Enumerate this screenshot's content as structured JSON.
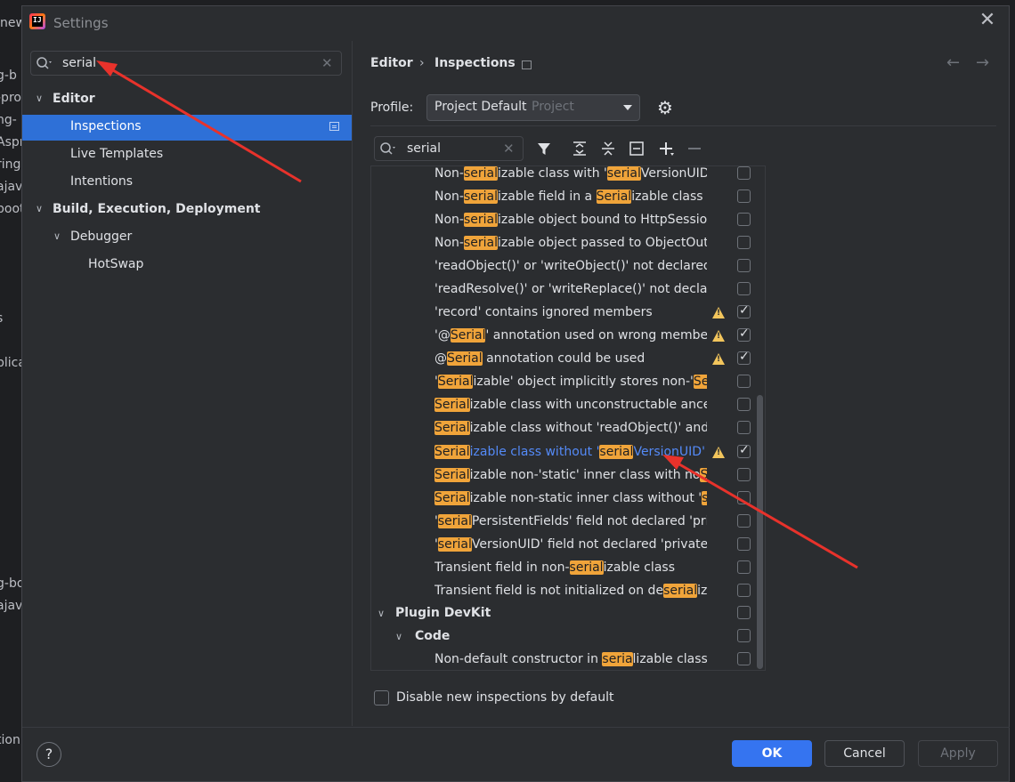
{
  "background": {
    "left_fragments": [
      "new",
      "g-b",
      "-pro",
      "ng-",
      "Aspr",
      "ring",
      "ajav",
      "boot",
      "s",
      "plica",
      "g-bo",
      "ajav",
      "tion"
    ]
  },
  "window": {
    "title": "Settings",
    "close_icon": "close-icon"
  },
  "left": {
    "search": {
      "value": "serial"
    },
    "tree": [
      {
        "label": "Editor",
        "bold": true
      },
      {
        "label": "Inspections",
        "selected": true
      },
      {
        "label": "Live Templates"
      },
      {
        "label": "Intentions"
      },
      {
        "label": "Build, Execution, Deployment",
        "bold": true
      },
      {
        "label": "Debugger"
      },
      {
        "label": "HotSwap"
      }
    ]
  },
  "right": {
    "breadcrumb": {
      "parent": "Editor",
      "sep": "›",
      "current": "Inspections"
    },
    "profile": {
      "label": "Profile:",
      "value": "Project Default",
      "sub": "Project"
    },
    "insp_search": {
      "value": "serial"
    },
    "inspections": [
      {
        "parts": [
          "Non-",
          "serial",
          "izable class with '",
          "serial",
          "VersionUID'"
        ],
        "checked": false,
        "warn": false
      },
      {
        "parts": [
          "Non-",
          "serial",
          "izable field in a ",
          "Serial",
          "izable class"
        ],
        "checked": false,
        "warn": false
      },
      {
        "parts": [
          "Non-",
          "serial",
          "izable object bound to HttpSession"
        ],
        "checked": false,
        "warn": false
      },
      {
        "parts": [
          "Non-",
          "serial",
          "izable object passed to ObjectOutp"
        ],
        "checked": false,
        "warn": false
      },
      {
        "parts": [
          "'readObject()' or 'writeObject()' not declared '"
        ],
        "checked": false,
        "warn": false
      },
      {
        "parts": [
          "'readResolve()' or 'writeReplace()' not declare"
        ],
        "checked": false,
        "warn": false
      },
      {
        "parts": [
          "'record' contains ignored members"
        ],
        "checked": true,
        "warn": true
      },
      {
        "parts": [
          "'@",
          "Serial",
          "' annotation used on wrong member"
        ],
        "checked": true,
        "warn": true
      },
      {
        "parts": [
          "@",
          "Serial",
          " annotation could be used"
        ],
        "checked": true,
        "warn": true
      },
      {
        "parts": [
          "'",
          "Serial",
          "izable' object implicitly stores non-'",
          "Seri"
        ],
        "checked": false,
        "warn": false
      },
      {
        "parts": [
          "",
          "Serial",
          "izable class with unconstructable ancest"
        ],
        "checked": false,
        "warn": false
      },
      {
        "parts": [
          "",
          "Serial",
          "izable class without 'readObject()' and 'v"
        ],
        "checked": false,
        "warn": false
      },
      {
        "parts": [
          "",
          "Serial",
          "izable class without '",
          "serial",
          "VersionUID'"
        ],
        "checked": true,
        "warn": true,
        "selected": true
      },
      {
        "parts": [
          "",
          "Serial",
          "izable non-'static' inner class with no",
          "S"
        ],
        "checked": false,
        "warn": false
      },
      {
        "parts": [
          "",
          "Serial",
          "izable non-static inner class without '",
          "ser"
        ],
        "checked": false,
        "warn": false
      },
      {
        "parts": [
          "'",
          "serial",
          "PersistentFields' field not declared 'priva"
        ],
        "checked": false,
        "warn": false
      },
      {
        "parts": [
          "'",
          "serial",
          "VersionUID' field not declared 'private s"
        ],
        "checked": false,
        "warn": false
      },
      {
        "parts": [
          "Transient field in non-",
          "serial",
          "izable class"
        ],
        "checked": false,
        "warn": false
      },
      {
        "parts": [
          "Transient field is not initialized on de",
          "serial",
          "izat"
        ],
        "checked": false,
        "warn": false
      }
    ],
    "groups": {
      "plugin": "Plugin DevKit",
      "code": "Code",
      "last_item": [
        "Non-default constructor in ",
        "seria",
        "lizable class"
      ]
    },
    "disable_label": "Disable new inspections by default"
  },
  "footer": {
    "help": "?",
    "ok": "OK",
    "cancel": "Cancel",
    "apply": "Apply"
  },
  "colors": {
    "accent": "#3574f0",
    "selection": "#2e70d7",
    "highlight": "#f0a43a",
    "arrow": "#e8322b"
  }
}
